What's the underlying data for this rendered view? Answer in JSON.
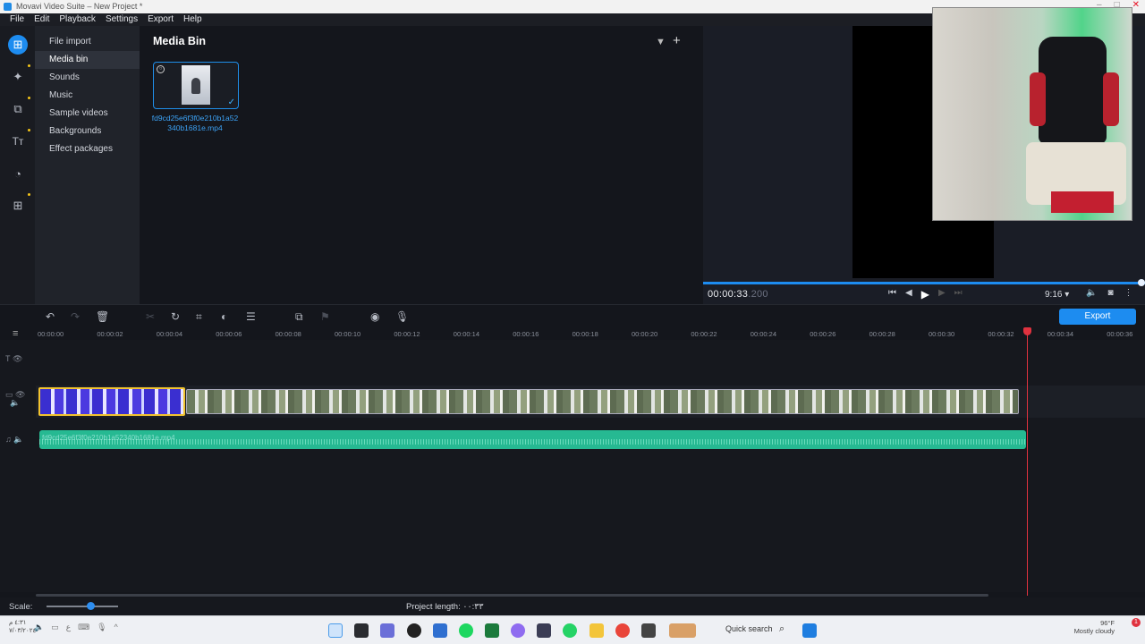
{
  "window": {
    "title": "Movavi Video Suite – New Project *",
    "controls": [
      "–",
      "□",
      "✕"
    ]
  },
  "menu": [
    "File",
    "Edit",
    "Playback",
    "Settings",
    "Export",
    "Help"
  ],
  "rail_icons": [
    "import-icon",
    "magic-wand-icon",
    "transitions-icon",
    "titles-icon",
    "stickers-icon",
    "more-tools-icon"
  ],
  "sidebar": {
    "items": [
      {
        "label": "File import"
      },
      {
        "label": "Media bin"
      },
      {
        "label": "Sounds"
      },
      {
        "label": "Music"
      },
      {
        "label": "Sample videos"
      },
      {
        "label": "Backgrounds"
      },
      {
        "label": "Effect packages"
      }
    ],
    "active_index": 1
  },
  "media_bin": {
    "title": "Media Bin",
    "files": [
      {
        "name": "fd9cd25e6f3f0e210b1a52340b1681e.mp4"
      }
    ]
  },
  "preview": {
    "time_main": "00:00:33",
    "time_ms": ".200",
    "aspect_ratio": "9:16 ▾",
    "progress": 1.0
  },
  "timeline": {
    "export_label": "Export",
    "ruler": [
      "00:00:00",
      "00:00:02",
      "00:00:04",
      "00:00:06",
      "00:00:08",
      "00:00:10",
      "00:00:12",
      "00:00:14",
      "00:00:16",
      "00:00:18",
      "00:00:20",
      "00:00:22",
      "00:00:24",
      "00:00:26",
      "00:00:28",
      "00:00:30",
      "00:00:32",
      "00:00:34",
      "00:00:36"
    ],
    "audio_clip_label": "fd9cd25e6f3f0e210b1a52340b1681e.mp4",
    "playhead_time": "00:00:33.200"
  },
  "footer": {
    "scale_label": "Scale:",
    "project_length": "Project length: ٠٠:٣٣"
  },
  "taskbar": {
    "search_placeholder": "Quick search",
    "clock_time": "٤:٣١ م",
    "clock_date": "٧/٠٣/٢٠٢٤",
    "weather_temp": "96°F",
    "weather_desc": "Mostly cloudy",
    "notification_count": "1"
  },
  "colors": {
    "accent": "#1d8cf0",
    "playhead": "#e0323f",
    "audio": "#26b992",
    "selection": "#f2c32f"
  }
}
